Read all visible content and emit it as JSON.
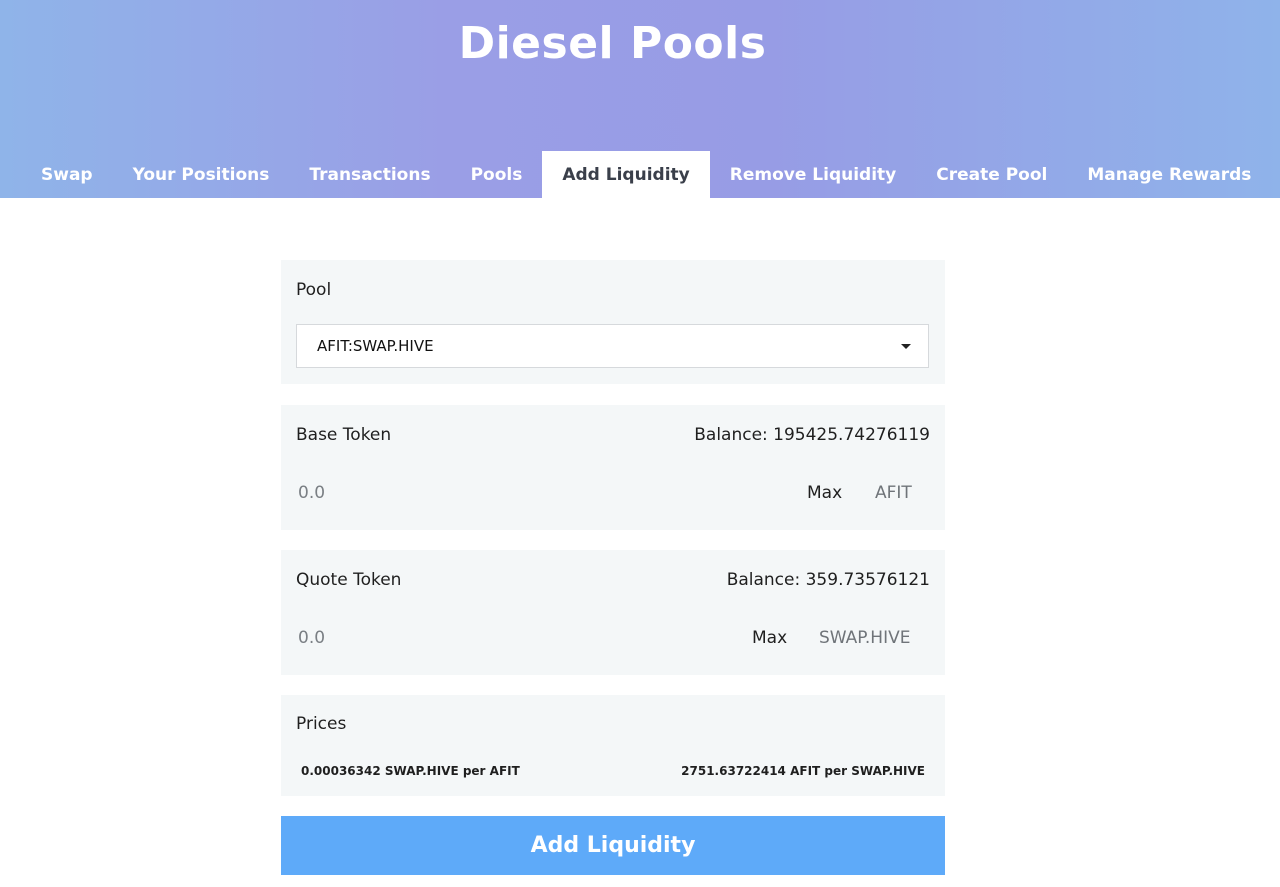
{
  "header": {
    "title": "Diesel Pools"
  },
  "tabs": [
    {
      "label": "Swap"
    },
    {
      "label": "Your Positions"
    },
    {
      "label": "Transactions"
    },
    {
      "label": "Pools"
    },
    {
      "label": "Add Liquidity",
      "active": true
    },
    {
      "label": "Remove Liquidity"
    },
    {
      "label": "Create Pool"
    },
    {
      "label": "Manage Rewards"
    }
  ],
  "pool": {
    "label": "Pool",
    "selected": "AFIT:SWAP.HIVE"
  },
  "base": {
    "label": "Base Token",
    "balance": "Balance: 195425.74276119",
    "placeholder": "0.0",
    "max_label": "Max",
    "symbol": "AFIT"
  },
  "quote": {
    "label": "Quote Token",
    "balance": "Balance: 359.73576121",
    "placeholder": "0.0",
    "max_label": "Max",
    "symbol": "SWAP.HIVE"
  },
  "prices": {
    "label": "Prices",
    "base_per_quote": "0.00036342 SWAP.HIVE per AFIT",
    "quote_per_base": "2751.63722414 AFIT per SWAP.HIVE"
  },
  "submit": {
    "label": "Add Liquidity"
  },
  "colors": {
    "accent": "#5eaaf9",
    "header_gradient_start": "#8fb4e9",
    "header_gradient_mid": "#9a9ee6",
    "panel_bg": "#f4f7f8"
  }
}
